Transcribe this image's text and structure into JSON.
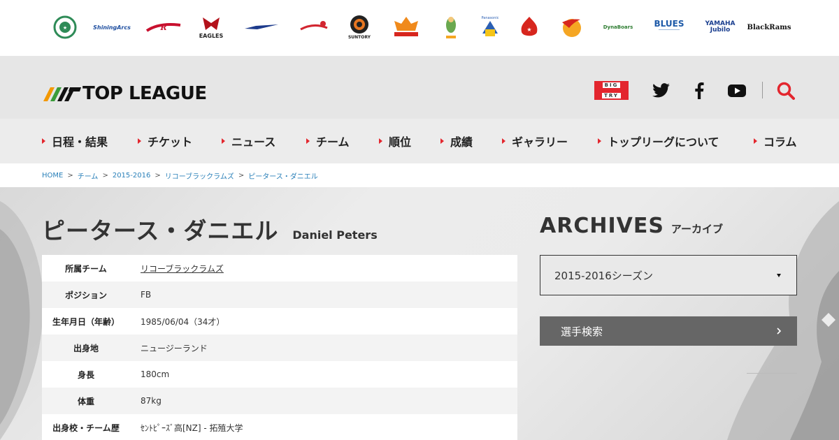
{
  "teams": [
    {
      "name": "team-logo-1",
      "text": "",
      "color": "#2e8b57"
    },
    {
      "name": "team-logo-2",
      "text": "ShiningArcs",
      "color": "#1f4fa0"
    },
    {
      "name": "team-logo-3",
      "text": "",
      "color": "#c8102e"
    },
    {
      "name": "team-logo-4",
      "text": "EAGLES",
      "color": "#b3121b"
    },
    {
      "name": "team-logo-5",
      "text": "",
      "color": "#1d3b8c"
    },
    {
      "name": "team-logo-6",
      "text": "",
      "color": "#d22630"
    },
    {
      "name": "team-logo-7",
      "text": "SUNTORY",
      "color": "#e87722"
    },
    {
      "name": "team-logo-8",
      "text": "",
      "color": "#f08a1c"
    },
    {
      "name": "team-logo-9",
      "text": "",
      "color": "#6aa84f"
    },
    {
      "name": "team-logo-10",
      "text": "",
      "color": "#2b5fb3"
    },
    {
      "name": "team-logo-11",
      "text": "",
      "color": "#d7261e"
    },
    {
      "name": "team-logo-12",
      "text": "",
      "color": "#f5a623"
    },
    {
      "name": "team-logo-13",
      "text": "DynaBoars",
      "color": "#2e7d32"
    },
    {
      "name": "team-logo-14",
      "text": "BLUES",
      "color": "#1e5aa8"
    },
    {
      "name": "team-logo-15",
      "text": "YAMAHA Jubilo",
      "color": "#1a3e8f"
    },
    {
      "name": "team-logo-16",
      "text": "BlackRams",
      "color": "#111111"
    }
  ],
  "header": {
    "brand": "TOP LEAGUE",
    "bigtry_top": "BIG",
    "bigtry_bottom": "TRY",
    "social": [
      "twitter-icon",
      "facebook-icon",
      "youtube-icon"
    ],
    "search_icon": "search-icon",
    "accent": "#e3262e"
  },
  "nav": {
    "items": [
      {
        "label": "日程・結果"
      },
      {
        "label": "チケット"
      },
      {
        "label": "ニュース"
      },
      {
        "label": "チーム"
      },
      {
        "label": "順位"
      },
      {
        "label": "成績"
      },
      {
        "label": "ギャラリー"
      },
      {
        "label": "トップリーグについて"
      },
      {
        "label": "コラム"
      }
    ]
  },
  "breadcrumb": [
    "HOME",
    "チーム",
    "2015-2016",
    "リコーブラックラムズ",
    "ピータース・ダニエル"
  ],
  "player": {
    "name_jp": "ピータース・ダニエル",
    "name_en": "Daniel Peters",
    "profile": [
      {
        "label": "所属チーム",
        "value": "リコーブラックラムズ",
        "link": true
      },
      {
        "label": "ポジション",
        "value": "FB"
      },
      {
        "label": "生年月日（年齢）",
        "value": "1985/06/04（34才）"
      },
      {
        "label": "出身地",
        "value": "ニュージーランド"
      },
      {
        "label": "身長",
        "value": "180cm"
      },
      {
        "label": "体重",
        "value": "87kg"
      },
      {
        "label": "出身校・チーム歴",
        "value": "ｾﾝﾄﾋﾟｰｽﾞ高[NZ] - 拓殖大学"
      }
    ]
  },
  "archives": {
    "title_en": "ARCHIVES",
    "title_jp": "アーカイブ",
    "season_value": "2015-2016シーズン",
    "search_label": "選手検索"
  }
}
